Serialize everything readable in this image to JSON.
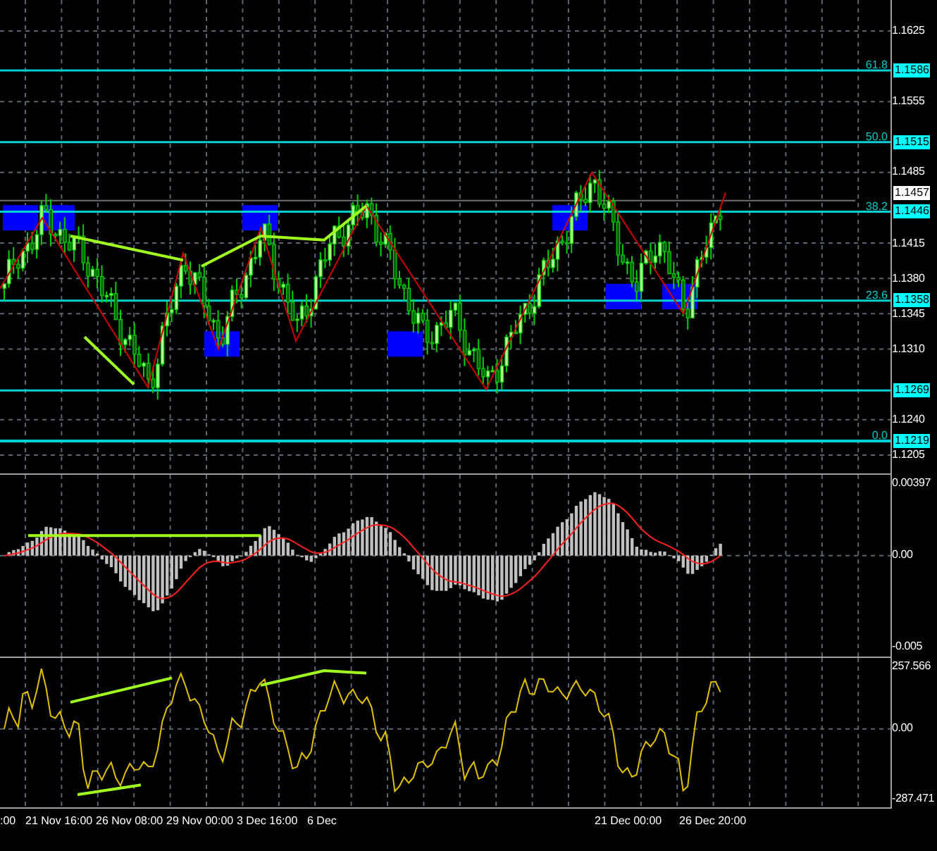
{
  "price_pane": {
    "scale": [
      "1.1625",
      "1.1555",
      "1.1485",
      "1.1415",
      "1.1380",
      "1.1345",
      "1.1310",
      "1.1240",
      "1.1205"
    ],
    "levels": [
      {
        "ratio": "61.8",
        "price": "1.1586"
      },
      {
        "ratio": "50.0",
        "price": "1.1515"
      },
      {
        "ratio": "38.2",
        "price": "1.1446"
      },
      {
        "ratio": "23.6",
        "price": "1.1358"
      },
      {
        "price": "1.1269"
      },
      {
        "ratio": "0.0",
        "price": "1.1219"
      }
    ],
    "current_price": "1.1457"
  },
  "macd_pane": {
    "scale": [
      "0.00397",
      "0.00",
      "-0.005"
    ]
  },
  "cci_pane": {
    "scale": [
      "257.566",
      "0.00",
      "-287.471"
    ]
  },
  "time_axis": [
    ":00",
    "21 Nov 16:00",
    "26 Nov 08:00",
    "29 Nov 00:00",
    "3 Dec 16:00",
    "6 Dec",
    "21 Dec 00:00",
    "26 Dec 20:00"
  ]
}
